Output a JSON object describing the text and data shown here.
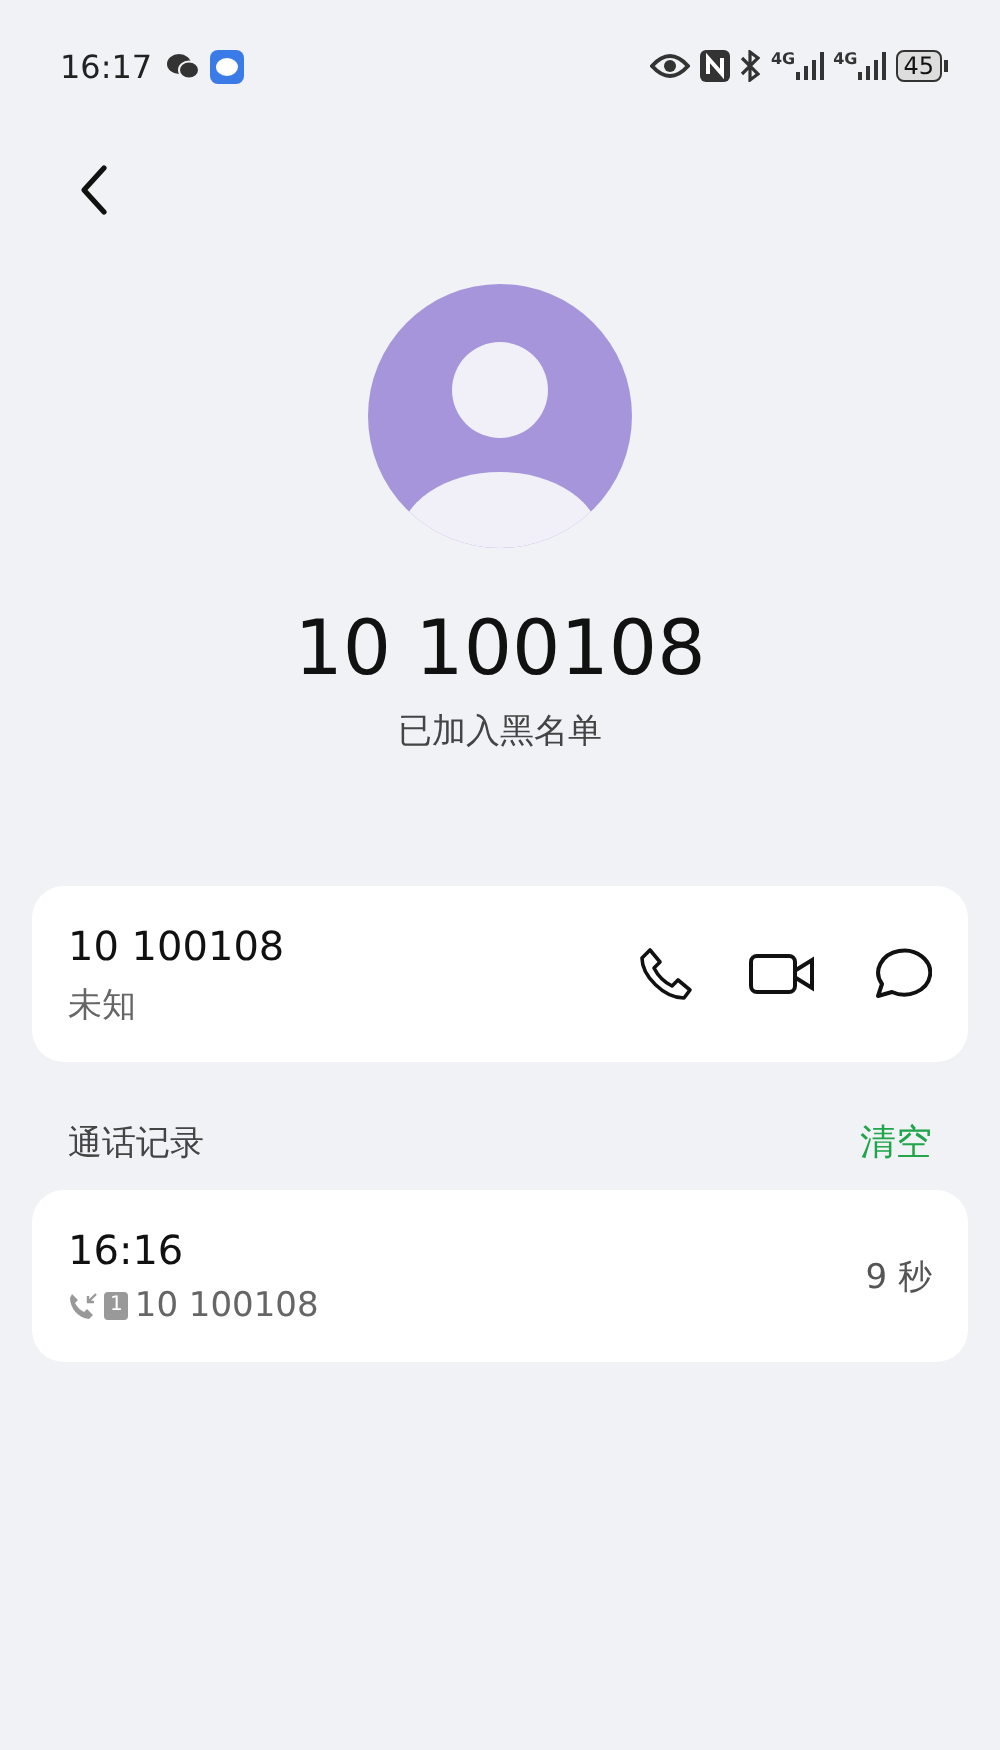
{
  "status_bar": {
    "time": "16:17",
    "network_labels": [
      "4G",
      "4G"
    ],
    "battery": "45"
  },
  "contact": {
    "name": "10 100108",
    "status": "已加入黑名单"
  },
  "number_card": {
    "number": "10 100108",
    "location": "未知"
  },
  "call_log": {
    "title": "通话记录",
    "clear": "清空",
    "entries": [
      {
        "time": "16:16",
        "sim": "1",
        "number": "10 100108",
        "duration": "9 秒",
        "kind": "incoming"
      }
    ]
  }
}
